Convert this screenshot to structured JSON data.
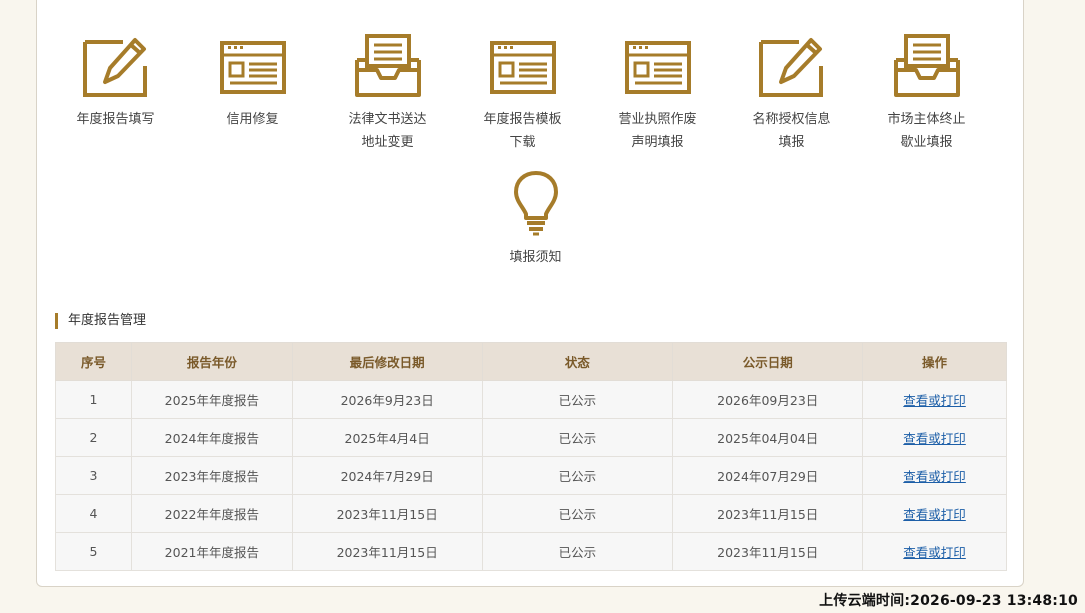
{
  "colors": {
    "accent": "#a67c2a",
    "header_bg": "#e8e0d6",
    "link": "#1d5fa8"
  },
  "icons": [
    {
      "name": "pencil-edit-icon",
      "lines": [
        "年度报告填写"
      ]
    },
    {
      "name": "document-window-icon",
      "lines": [
        "信用修复"
      ]
    },
    {
      "name": "inbox-tray-icon",
      "lines": [
        "法律文书送达",
        "地址变更"
      ]
    },
    {
      "name": "document-window-icon",
      "lines": [
        "年度报告模板",
        "下载"
      ]
    },
    {
      "name": "document-window-icon",
      "lines": [
        "营业执照作废",
        "声明填报"
      ]
    },
    {
      "name": "pencil-edit-icon",
      "lines": [
        "名称授权信息",
        "填报"
      ]
    },
    {
      "name": "inbox-tray-icon",
      "lines": [
        "市场主体终止",
        "歇业填报"
      ]
    },
    {
      "name": "lightbulb-icon",
      "lines": [
        "填报须知"
      ]
    }
  ],
  "section_title": "年度报告管理",
  "table": {
    "headers": [
      "序号",
      "报告年份",
      "最后修改日期",
      "状态",
      "公示日期",
      "操作"
    ],
    "rows": [
      [
        "1",
        "2025年年度报告",
        "2026年9月23日",
        "已公示",
        "2026年09月23日",
        "查看或打印"
      ],
      [
        "2",
        "2024年年度报告",
        "2025年4月4日",
        "已公示",
        "2025年04月04日",
        "查看或打印"
      ],
      [
        "3",
        "2023年年度报告",
        "2024年7月29日",
        "已公示",
        "2024年07月29日",
        "查看或打印"
      ],
      [
        "4",
        "2022年年度报告",
        "2023年11月15日",
        "已公示",
        "2023年11月15日",
        "查看或打印"
      ],
      [
        "5",
        "2021年年度报告",
        "2023年11月15日",
        "已公示",
        "2023年11月15日",
        "查看或打印"
      ]
    ]
  },
  "footer_time": "上传云端时间:2026-09-23 13:48:10"
}
